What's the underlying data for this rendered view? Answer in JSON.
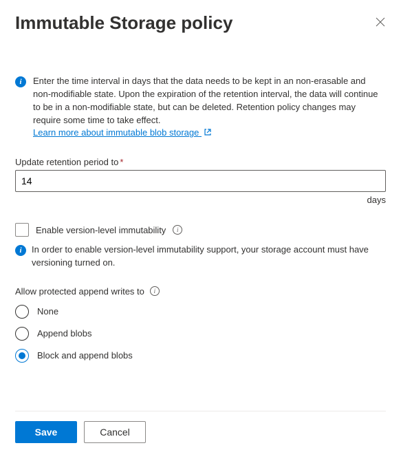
{
  "header": {
    "title": "Immutable Storage policy"
  },
  "intro": {
    "text": "Enter the time interval in days that the data needs to be kept in an non-erasable and non-modifiable state. Upon the expiration of the retention interval, the data will continue to be in a non-modifiable state, but can be deleted. Retention policy changes may require some time to take effect.",
    "link_text": "Learn more about immutable blob storage"
  },
  "retention": {
    "label": "Update retention period to",
    "value": "14",
    "unit": "days"
  },
  "version_level": {
    "checkbox_label": "Enable version-level immutability",
    "note": "In order to enable version-level immutability support, your storage account must have versioning turned on."
  },
  "append_writes": {
    "label": "Allow protected append writes to",
    "options": {
      "none": "None",
      "append": "Append blobs",
      "block_append": "Block and append blobs"
    },
    "selected": "block_append"
  },
  "footer": {
    "save": "Save",
    "cancel": "Cancel"
  }
}
